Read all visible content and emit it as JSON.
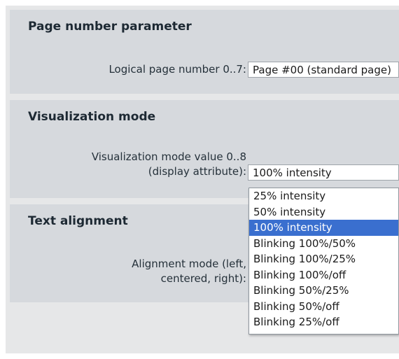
{
  "page_number": {
    "title": "Page number parameter",
    "label": "Logical page number 0..7:",
    "value": "Page #00 (standard page)"
  },
  "visualization": {
    "title": "Visualization mode",
    "label_line1": "Visualization mode value 0..8",
    "label_line2": "(display attribute):",
    "value": "100% intensity",
    "options": [
      {
        "label": "25% intensity",
        "selected": false
      },
      {
        "label": "50% intensity",
        "selected": false
      },
      {
        "label": "100% intensity",
        "selected": true
      },
      {
        "label": "Blinking 100%/50%",
        "selected": false
      },
      {
        "label": "Blinking 100%/25%",
        "selected": false
      },
      {
        "label": "Blinking 100%/off",
        "selected": false
      },
      {
        "label": "Blinking 50%/25%",
        "selected": false
      },
      {
        "label": "Blinking 50%/off",
        "selected": false
      },
      {
        "label": "Blinking 25%/off",
        "selected": false
      }
    ]
  },
  "text_alignment": {
    "title": "Text alignment",
    "label_line1": "Alignment mode (left,",
    "label_line2": "centered, right):"
  },
  "colors": {
    "selected_option_bg": "#3a6fcf"
  }
}
